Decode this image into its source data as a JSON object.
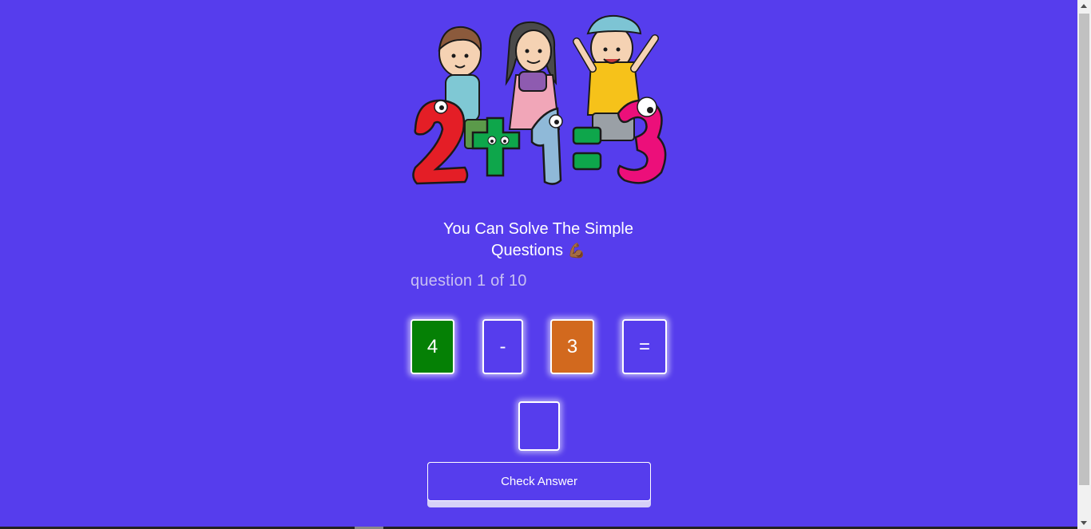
{
  "colors": {
    "background": "#563ded",
    "card_number_a": "#058005",
    "card_number_b": "#d2691e",
    "text": "#ffffff",
    "muted_text": "#c8c0f2"
  },
  "hero": {
    "illustration": "kids-with-math-numbers-2-plus-1-equals-3"
  },
  "header": {
    "title": "You Can Solve The Simple Questions",
    "title_emoji": "💪🏾"
  },
  "progress": {
    "label": "question",
    "current": "1",
    "separator": "of",
    "total": "10"
  },
  "equation": {
    "operand_a": "4",
    "operator": "-",
    "operand_b": "3",
    "equals": "="
  },
  "answer": {
    "value": "",
    "placeholder": ""
  },
  "actions": {
    "check_label": "Check Answer"
  }
}
